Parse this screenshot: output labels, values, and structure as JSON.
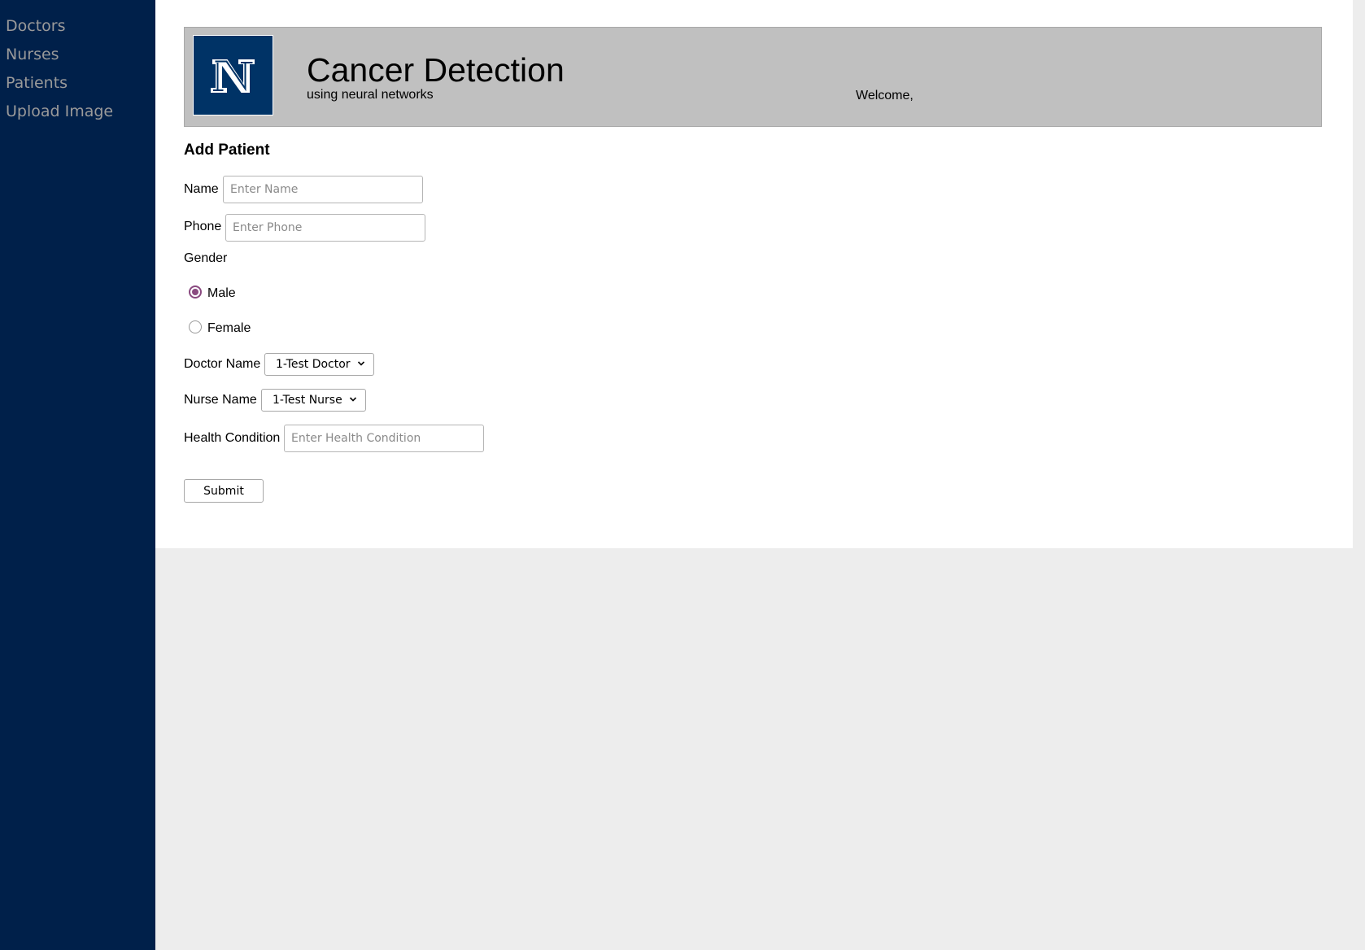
{
  "sidebar": {
    "items": [
      {
        "label": "Doctors"
      },
      {
        "label": "Nurses"
      },
      {
        "label": "Patients"
      },
      {
        "label": "Upload Image"
      }
    ]
  },
  "header": {
    "logo_icon": "university-n-logo-icon",
    "title": "Cancer Detection",
    "subtitle": "using neural networks",
    "welcome": "Welcome,"
  },
  "form": {
    "title": "Add Patient",
    "name": {
      "label": "Name",
      "placeholder": "Enter Name",
      "value": ""
    },
    "phone": {
      "label": "Phone",
      "placeholder": "Enter Phone",
      "value": ""
    },
    "gender": {
      "label": "Gender",
      "options": [
        {
          "label": "Male",
          "checked": true
        },
        {
          "label": "Female",
          "checked": false
        }
      ]
    },
    "doctor": {
      "label": "Doctor Name",
      "selected": "1-Test Doctor"
    },
    "nurse": {
      "label": "Nurse Name",
      "selected": "1-Test Nurse"
    },
    "health": {
      "label": "Health Condition",
      "placeholder": "Enter Health Condition",
      "value": ""
    },
    "submit_label": "Submit"
  },
  "colors": {
    "sidebar_bg": "#00204a",
    "header_bg": "#c0c0c0",
    "logo_bg": "#003366",
    "radio_accent": "#8a4a80"
  }
}
